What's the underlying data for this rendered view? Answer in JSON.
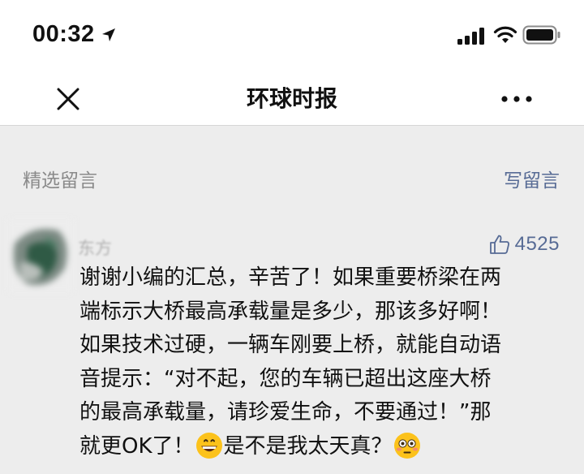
{
  "status_bar": {
    "time": "00:32",
    "location_icon": "location-arrow-icon",
    "signal_icon": "cellular-signal-icon",
    "wifi_icon": "wifi-icon",
    "battery_icon": "battery-icon"
  },
  "nav": {
    "title": "环球时报",
    "close_icon": "close-icon",
    "more_icon": "more-dots-icon"
  },
  "section": {
    "title": "精选留言",
    "write_label": "写留言"
  },
  "comment": {
    "author": "东方",
    "likes": "4525",
    "like_icon": "thumbs-up-icon",
    "lines": {
      "l1": "谢谢小编的汇总，辛苦了！如果重要桥梁在两",
      "l2": "端标示大桥最高承载量是多少，那该多好啊！",
      "l3": "如果技术过硬，一辆车刚要上桥，就能自动语",
      "l4": "音提示：“对不起，您的车辆已超出这座大桥",
      "l5": "的最高承载量，请珍爱生命，不要通过！”那",
      "l6a": "就更OK了！",
      "l6b": "是不是我太天真？"
    },
    "emoji_1": "grinning-face-icon",
    "emoji_2": "flushed-face-icon"
  },
  "colors": {
    "link": "#576b95",
    "muted": "#8a8a8a",
    "background": "#ededed"
  }
}
